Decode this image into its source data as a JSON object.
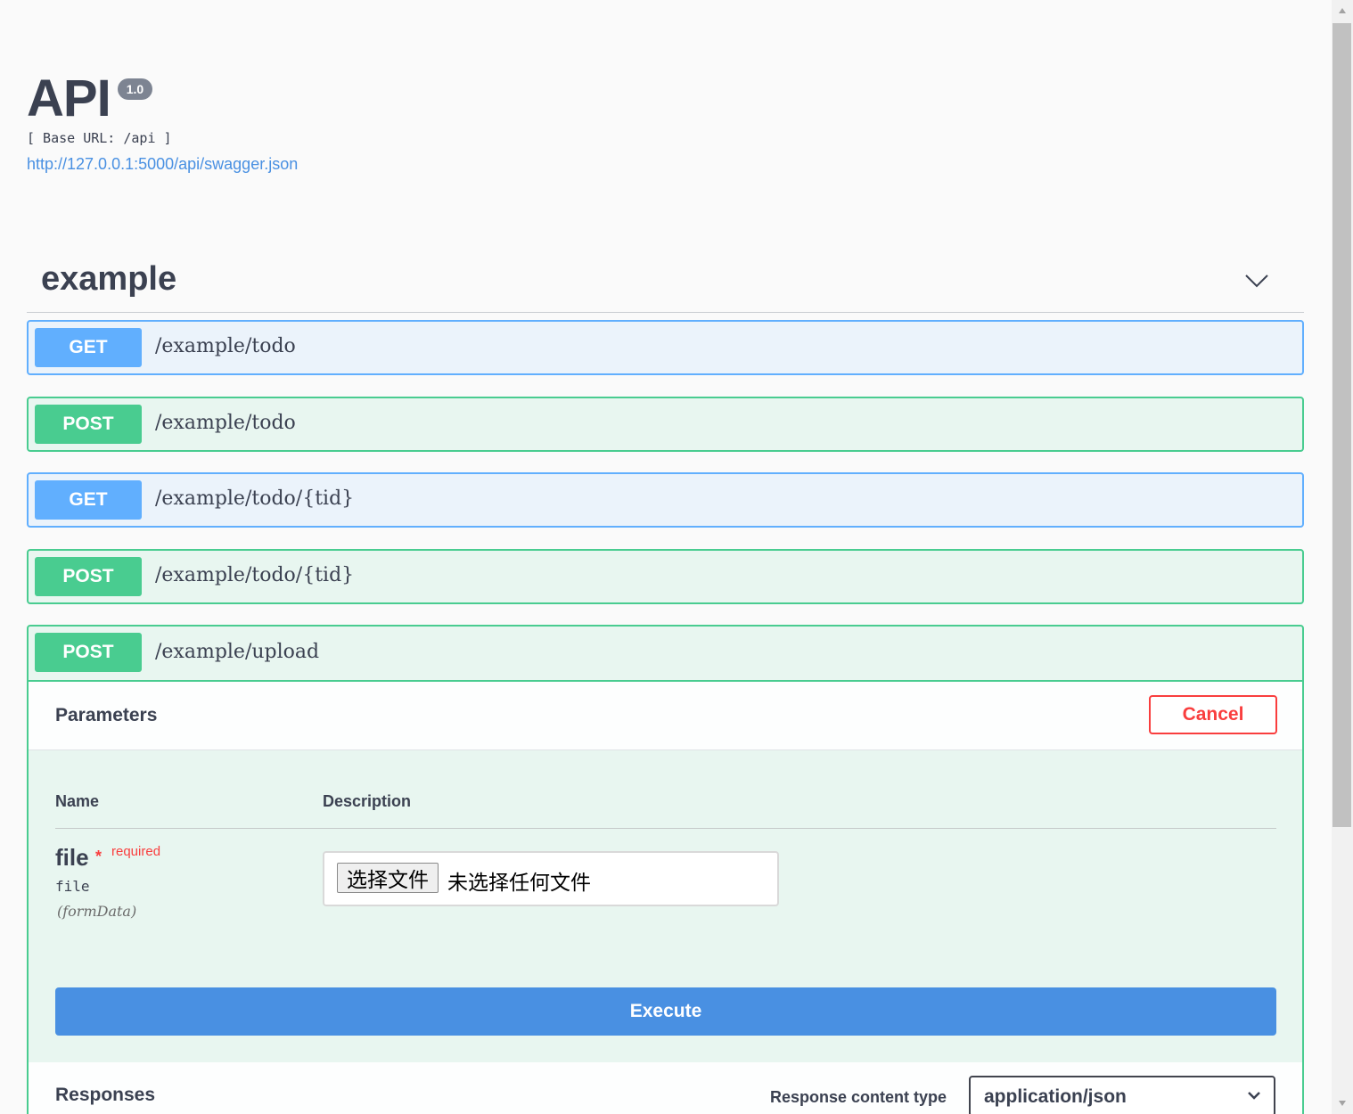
{
  "info": {
    "title": "API",
    "version": "1.0",
    "base_url": "[ Base URL: /api ]",
    "spec_url": "http://127.0.0.1:5000/api/swagger.json"
  },
  "tag": {
    "name": "example",
    "toggle_icon": "chevron-down-icon"
  },
  "operations": [
    {
      "method": "GET",
      "path": "/example/todo"
    },
    {
      "method": "POST",
      "path": "/example/todo"
    },
    {
      "method": "GET",
      "path": "/example/todo/{tid}"
    },
    {
      "method": "POST",
      "path": "/example/todo/{tid}"
    },
    {
      "method": "POST",
      "path": "/example/upload"
    }
  ],
  "expanded": {
    "parameters_title": "Parameters",
    "cancel_label": "Cancel",
    "col_name": "Name",
    "col_description": "Description",
    "param": {
      "name": "file",
      "required_star": "*",
      "required_label": "required",
      "type": "file",
      "in": "(formData)"
    },
    "file_input": {
      "button_label": "选择文件",
      "status": "未选择任何文件"
    },
    "execute_label": "Execute",
    "responses_title": "Responses",
    "response_ct_label": "Response content type",
    "response_ct_value": "application/json"
  },
  "colors": {
    "get": "#61affe",
    "post": "#49cc90",
    "execute": "#4990e2",
    "cancel": "#f93e3e",
    "link": "#4990e2"
  }
}
